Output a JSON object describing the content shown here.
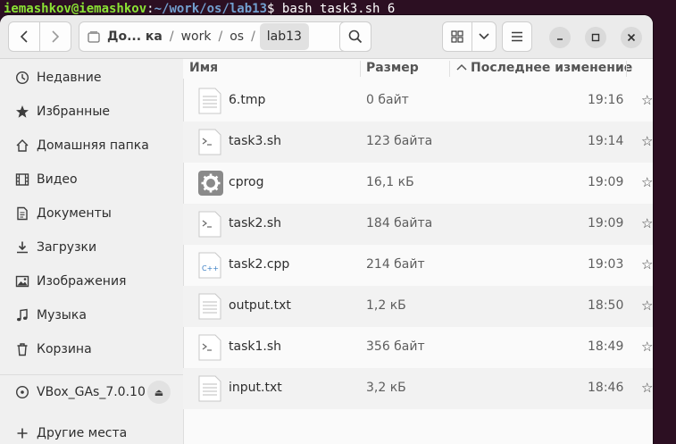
{
  "terminal": {
    "user_host": "iemashkov@iemashkov",
    "colon": ":",
    "path": "~/work/os/lab13",
    "prompt_suffix": "$ ",
    "command": "bash task3.sh 6"
  },
  "header": {
    "breadcrumbs": [
      "До... ка",
      "work",
      "os",
      "lab13"
    ],
    "icons": [
      "back-icon",
      "forward-icon",
      "home-drive-icon",
      "more-icon",
      "search-icon",
      "grid-view-icon",
      "chevron-down-icon",
      "menu-icon",
      "minimize-icon",
      "maximize-icon",
      "close-icon"
    ]
  },
  "sidebar": {
    "items": [
      {
        "label": "Недавние",
        "icon": "clock-icon"
      },
      {
        "label": "Избранные",
        "icon": "star-icon"
      },
      {
        "label": "Домашняя папка",
        "icon": "home-icon"
      },
      {
        "label": "Видео",
        "icon": "film-icon"
      },
      {
        "label": "Документы",
        "icon": "document-icon"
      },
      {
        "label": "Загрузки",
        "icon": "download-icon"
      },
      {
        "label": "Изображения",
        "icon": "image-icon"
      },
      {
        "label": "Музыка",
        "icon": "music-icon"
      },
      {
        "label": "Корзина",
        "icon": "trash-icon"
      }
    ],
    "drive": {
      "label": "VBox_GAs_7.0.10",
      "icon": "disc-icon"
    },
    "other": {
      "label": "Другие места",
      "icon": "plus-icon"
    }
  },
  "columns": {
    "name": "Имя",
    "size": "Размер",
    "modified": "Последнее изменение"
  },
  "files": [
    {
      "name": "6.tmp",
      "size": "0 байт",
      "time": "19:16",
      "icon": "text-file-icon"
    },
    {
      "name": "task3.sh",
      "size": "123 байта",
      "time": "19:14",
      "icon": "script-file-icon"
    },
    {
      "name": "cprog",
      "size": "16,1 кБ",
      "time": "19:09",
      "icon": "executable-icon"
    },
    {
      "name": "task2.sh",
      "size": "184 байта",
      "time": "19:09",
      "icon": "script-file-icon"
    },
    {
      "name": "task2.cpp",
      "size": "214 байт",
      "time": "19:03",
      "icon": "cpp-file-icon"
    },
    {
      "name": "output.txt",
      "size": "1,2 кБ",
      "time": "18:50",
      "icon": "text-file-icon"
    },
    {
      "name": "task1.sh",
      "size": "356 байт",
      "time": "18:49",
      "icon": "script-file-icon"
    },
    {
      "name": "input.txt",
      "size": "3,2 кБ",
      "time": "18:46",
      "icon": "text-file-icon"
    }
  ],
  "colors": {
    "desktop_bg": "#2c0f22",
    "terminal_user": "#8ae234",
    "terminal_path": "#729fcf"
  }
}
